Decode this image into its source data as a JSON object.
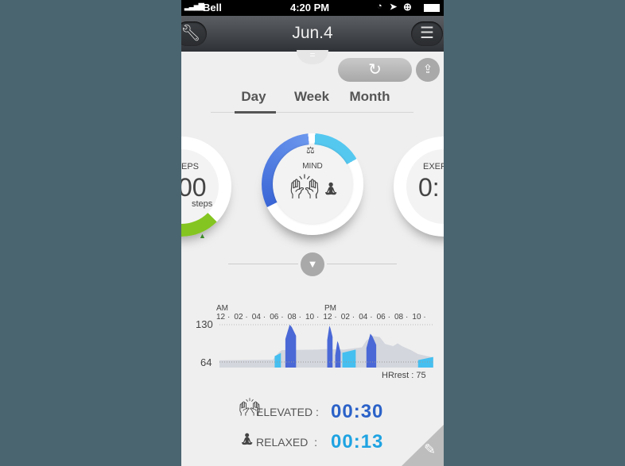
{
  "status_bar": {
    "carrier": "Bell",
    "time": "4:20 PM",
    "icons": [
      "signal-icon",
      "clock-icon",
      "location-icon",
      "rotation-lock-icon",
      "battery-icon"
    ]
  },
  "header": {
    "title": "Jun.4",
    "left_icon": "wrench-icon",
    "right_icon": "menu-icon"
  },
  "toolbar": {
    "refresh_icon": "refresh-icon",
    "share_icon": "share-icon"
  },
  "tabs": [
    {
      "label": "Day",
      "active": true
    },
    {
      "label": "Week",
      "active": false
    },
    {
      "label": "Month",
      "active": false
    }
  ],
  "widgets": {
    "steps": {
      "label": "EPS",
      "value": "00",
      "unit": "steps",
      "color": "#7cc11e"
    },
    "mind": {
      "label": "MIND",
      "elevated_color": "#3e6fd8",
      "relaxed_color": "#55c8f0"
    },
    "exercise": {
      "label": "EXER",
      "value": "0:"
    }
  },
  "chart": {
    "am_label": "AM",
    "pm_label": "PM",
    "tick_labels": [
      "12",
      "02",
      "04",
      "06",
      "08",
      "10",
      "12",
      "02",
      "04",
      "06",
      "08",
      "10"
    ],
    "y_max_label": "130",
    "y_min_label": "64",
    "hrrest": "HRrest : 75",
    "background_series": [
      [
        0,
        67
      ],
      [
        6,
        68
      ],
      [
        6.6,
        80
      ],
      [
        7,
        85
      ],
      [
        11,
        86
      ],
      [
        12,
        87
      ],
      [
        14,
        86
      ],
      [
        16,
        90
      ],
      [
        16.5,
        102
      ],
      [
        17.2,
        110
      ],
      [
        18,
        108
      ],
      [
        18.6,
        96
      ],
      [
        19.5,
        92
      ],
      [
        20,
        97
      ],
      [
        20.5,
        92
      ],
      [
        21.5,
        85
      ],
      [
        22.3,
        78
      ],
      [
        24,
        72
      ]
    ],
    "segments": [
      {
        "type": "relaxed",
        "start": 6.2,
        "end": 6.9,
        "level": 80
      },
      {
        "type": "elevated",
        "start": 7.4,
        "end": 8.6,
        "level": 130
      },
      {
        "type": "elevated",
        "start": 12.1,
        "end": 12.7,
        "level": 128
      },
      {
        "type": "elevated",
        "start": 13.0,
        "end": 13.6,
        "level": 101
      },
      {
        "type": "relaxed",
        "start": 13.8,
        "end": 15.3,
        "level": 86
      },
      {
        "type": "elevated",
        "start": 16.5,
        "end": 17.6,
        "level": 114
      },
      {
        "type": "relaxed",
        "start": 22.3,
        "end": 24,
        "level": 73
      }
    ]
  },
  "summary": {
    "elevated": {
      "label": "ELEVATED :",
      "value": "00:30",
      "color": "#2b62c8"
    },
    "relaxed": {
      "label": "RELAXED  :",
      "value": "00:13",
      "color": "#1ea3e2"
    }
  },
  "edit_icon": "pencil-icon"
}
